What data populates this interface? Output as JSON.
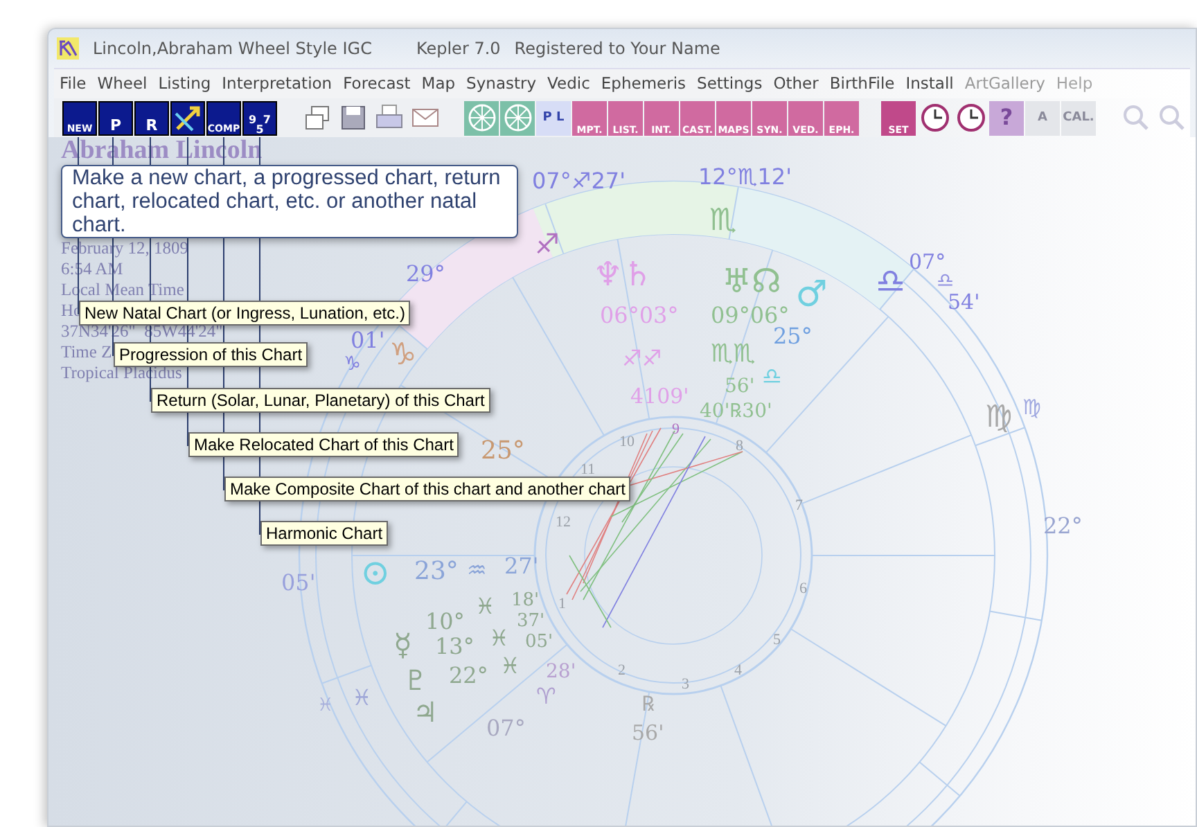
{
  "window": {
    "title": "Lincoln,Abraham Wheel Style IGC",
    "version": "Kepler 7.0",
    "registration": "Registered to Your Name"
  },
  "menu": [
    "File",
    "Wheel",
    "Listing",
    "Interpretation",
    "Forecast",
    "Map",
    "Synastry",
    "Vedic",
    "Ephemeris",
    "Settings",
    "Other",
    "BirthFile",
    "Install",
    "ArtGallery",
    "Help"
  ],
  "toolbar": [
    {
      "kind": "chart",
      "label": "NEW"
    },
    {
      "kind": "chart",
      "label": "P"
    },
    {
      "kind": "chart",
      "label": "R"
    },
    {
      "kind": "chart-arrow"
    },
    {
      "kind": "chart",
      "label": "COMP"
    },
    {
      "kind": "chart",
      "label": "9 7 5"
    },
    {
      "kind": "gap"
    },
    {
      "kind": "windows"
    },
    {
      "kind": "save"
    },
    {
      "kind": "print"
    },
    {
      "kind": "mail"
    },
    {
      "kind": "gap"
    },
    {
      "kind": "wheel"
    },
    {
      "kind": "wheel"
    },
    {
      "kind": "pl",
      "label": "P L"
    },
    {
      "kind": "pink",
      "label": "MPT."
    },
    {
      "kind": "pink",
      "label": "LIST."
    },
    {
      "kind": "pink",
      "label": "INT."
    },
    {
      "kind": "pink",
      "label": "CAST."
    },
    {
      "kind": "pink",
      "label": "MAPS"
    },
    {
      "kind": "pink",
      "label": "SYN."
    },
    {
      "kind": "pink",
      "label": "VED."
    },
    {
      "kind": "pink",
      "label": "EPH."
    },
    {
      "kind": "gap"
    },
    {
      "kind": "set",
      "label": "SET"
    },
    {
      "kind": "clock"
    },
    {
      "kind": "clock"
    },
    {
      "kind": "help",
      "label": "?"
    },
    {
      "kind": "pale",
      "label": "A"
    },
    {
      "kind": "pale",
      "label": "CAL."
    },
    {
      "kind": "gap"
    },
    {
      "kind": "zoom"
    },
    {
      "kind": "zoom"
    }
  ],
  "chart_info": {
    "name": "Abraham Lincoln",
    "lines": [
      "February 12, 1809",
      "6:54 AM",
      "Local Mean Time",
      "Ho",
      "37N34'26\"  85W44'24\"",
      "Time Z",
      "Tropical Placidus"
    ]
  },
  "wheel": {
    "labels": [
      {
        "text": "07°♐27'",
        "color": "#8080e0"
      },
      {
        "text": "12°♏12'",
        "color": "#8080e0"
      },
      {
        "text": "♏",
        "color": "#90c090"
      },
      {
        "text": "♐",
        "color": "#b070c0"
      },
      {
        "text": "29°",
        "color": "#8080e0"
      },
      {
        "text": "♆♄",
        "color": "#e0a0e8"
      },
      {
        "text": "♅☊",
        "color": "#90c090"
      },
      {
        "text": "♂",
        "color": "#70d0e0"
      },
      {
        "text": "06°03°",
        "color": "#e0a0e8"
      },
      {
        "text": "09°06°",
        "color": "#90c090"
      },
      {
        "text": "25°",
        "color": "#70a0e0"
      },
      {
        "text": "♐♐",
        "color": "#e0a0e8"
      },
      {
        "text": "♏♏",
        "color": "#90c090"
      },
      {
        "text": "56'",
        "color": "#90c090"
      },
      {
        "text": "♎",
        "color": "#70d0e0"
      },
      {
        "text": "4109'",
        "color": "#e0a0e8"
      },
      {
        "text": "40'℞30'",
        "color": "#90c090"
      },
      {
        "text": "♎",
        "color": "#8080e0"
      },
      {
        "text": "07°",
        "color": "#8080e0"
      },
      {
        "text": "♎",
        "color": "#9090e0"
      },
      {
        "text": "54'",
        "color": "#8080e0"
      },
      {
        "text": "♍",
        "color": "#a8a8a8"
      },
      {
        "text": "♍",
        "color": "#a0a8e0"
      },
      {
        "text": "22°",
        "color": "#98a4d0"
      },
      {
        "text": "01'",
        "color": "#8080e0"
      },
      {
        "text": "♑",
        "color": "#8080e0"
      },
      {
        "text": "♑",
        "color": "#d0a080"
      },
      {
        "text": "25°",
        "color": "#c89870"
      },
      {
        "text": "⊙",
        "color": "#70d0e0"
      },
      {
        "text": "23°",
        "color": "#8aa4d8"
      },
      {
        "text": "♒",
        "color": "#8aa4d8"
      },
      {
        "text": "27'",
        "color": "#8aa4d8"
      },
      {
        "text": "05'",
        "color": "#98a0dc"
      },
      {
        "text": "10°",
        "color": "#8fa88f"
      },
      {
        "text": "13°",
        "color": "#8fa88f"
      },
      {
        "text": "22°",
        "color": "#8fa88f"
      },
      {
        "text": "18'",
        "color": "#8fa88f"
      },
      {
        "text": "37'",
        "color": "#8fa88f"
      },
      {
        "text": "05'",
        "color": "#8fa88f"
      },
      {
        "text": "♓",
        "color": "#8fa88f"
      },
      {
        "text": "♓",
        "color": "#8fa88f"
      },
      {
        "text": "♓",
        "color": "#8fa88f"
      },
      {
        "text": "☿",
        "color": "#8fa88f"
      },
      {
        "text": "♇",
        "color": "#8fa88f"
      },
      {
        "text": "♓",
        "color": "#a8b0dc"
      },
      {
        "text": "♓",
        "color": "#a0a8d8"
      },
      {
        "text": "♃",
        "color": "#8fa88f"
      },
      {
        "text": "28'",
        "color": "#b8a0d0"
      },
      {
        "text": "♈",
        "color": "#b0a0d0"
      },
      {
        "text": "07°",
        "color": "#a8a8c0"
      },
      {
        "text": "℞",
        "color": "#a8a8a8"
      },
      {
        "text": "56'",
        "color": "#a8a8a8"
      }
    ],
    "house_numbers": [
      "9",
      "10",
      "8",
      "11",
      "7",
      "12",
      "1",
      "6",
      "5",
      "2",
      "3",
      "4"
    ]
  },
  "help_balloon": "Make a new chart, a progressed chart, return chart, relocated chart, etc. or another natal chart.",
  "tooltips": [
    "New Natal Chart (or Ingress, Lunation, etc.)",
    "Progression of this Chart",
    "Return (Solar, Lunar, Planetary) of this Chart",
    "Make Relocated Chart of this Chart",
    "Make Composite Chart of this chart and another chart",
    "Harmonic Chart"
  ]
}
